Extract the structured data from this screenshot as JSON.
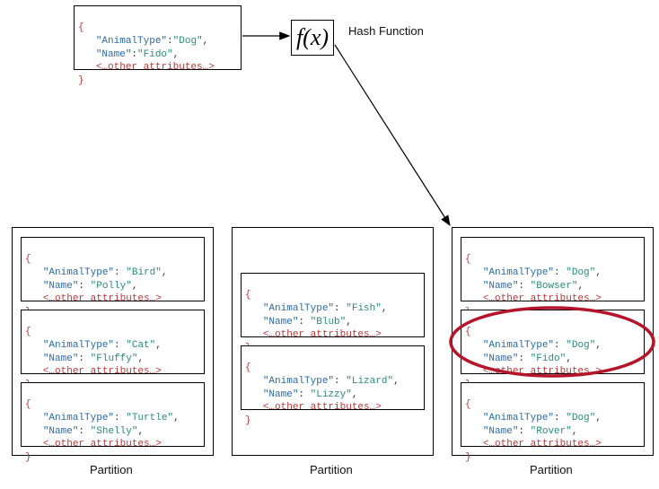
{
  "input": {
    "animalTypeKey": "\"AnimalType\"",
    "animalTypeVal": "\"Dog\"",
    "nameKey": "\"Name\"",
    "nameVal": "\"Fido\"",
    "other": "<…other attributes…>"
  },
  "hash": {
    "fx": "f(x)",
    "label": "Hash Function"
  },
  "partitions": {
    "label": "Partition",
    "p1": {
      "items": [
        {
          "atKey": "\"AnimalType\"",
          "atVal": "\"Bird\"",
          "nKey": "\"Name\"",
          "nVal": "\"Polly\"",
          "other": "<…other attributes…>"
        },
        {
          "atKey": "\"AnimalType\"",
          "atVal": "\"Cat\"",
          "nKey": "\"Name\"",
          "nVal": "\"Fluffy\"",
          "other": "<…other attributes…>"
        },
        {
          "atKey": "\"AnimalType\"",
          "atVal": "\"Turtle\"",
          "nKey": "\"Name\"",
          "nVal": "\"Shelly\"",
          "other": "<…other attributes…>"
        }
      ]
    },
    "p2": {
      "items": [
        {
          "atKey": "\"AnimalType\"",
          "atVal": "\"Fish\"",
          "nKey": "\"Name\"",
          "nVal": "\"Blub\"",
          "other": "<…other attributes…>"
        },
        {
          "atKey": "\"AnimalType\"",
          "atVal": "\"Lizard\"",
          "nKey": "\"Name\"",
          "nVal": "\"Lizzy\"",
          "other": "<…other attributes…>"
        }
      ]
    },
    "p3": {
      "items": [
        {
          "atKey": "\"AnimalType\"",
          "atVal": "\"Dog\"",
          "nKey": "\"Name\"",
          "nVal": "\"Bowser\"",
          "other": "<…other attributes…>"
        },
        {
          "atKey": "\"AnimalType\"",
          "atVal": "\"Dog\"",
          "nKey": "\"Name\"",
          "nVal": "\"Fido\"",
          "other": "<…other attributes…>"
        },
        {
          "atKey": "\"AnimalType\"",
          "atVal": "\"Dog\"",
          "nKey": "\"Name\"",
          "nVal": "\"Rover\"",
          "other": "<…other attributes…>"
        }
      ]
    }
  },
  "brace_open": "{",
  "brace_close": "}",
  "comma": ",",
  "colon": ":"
}
